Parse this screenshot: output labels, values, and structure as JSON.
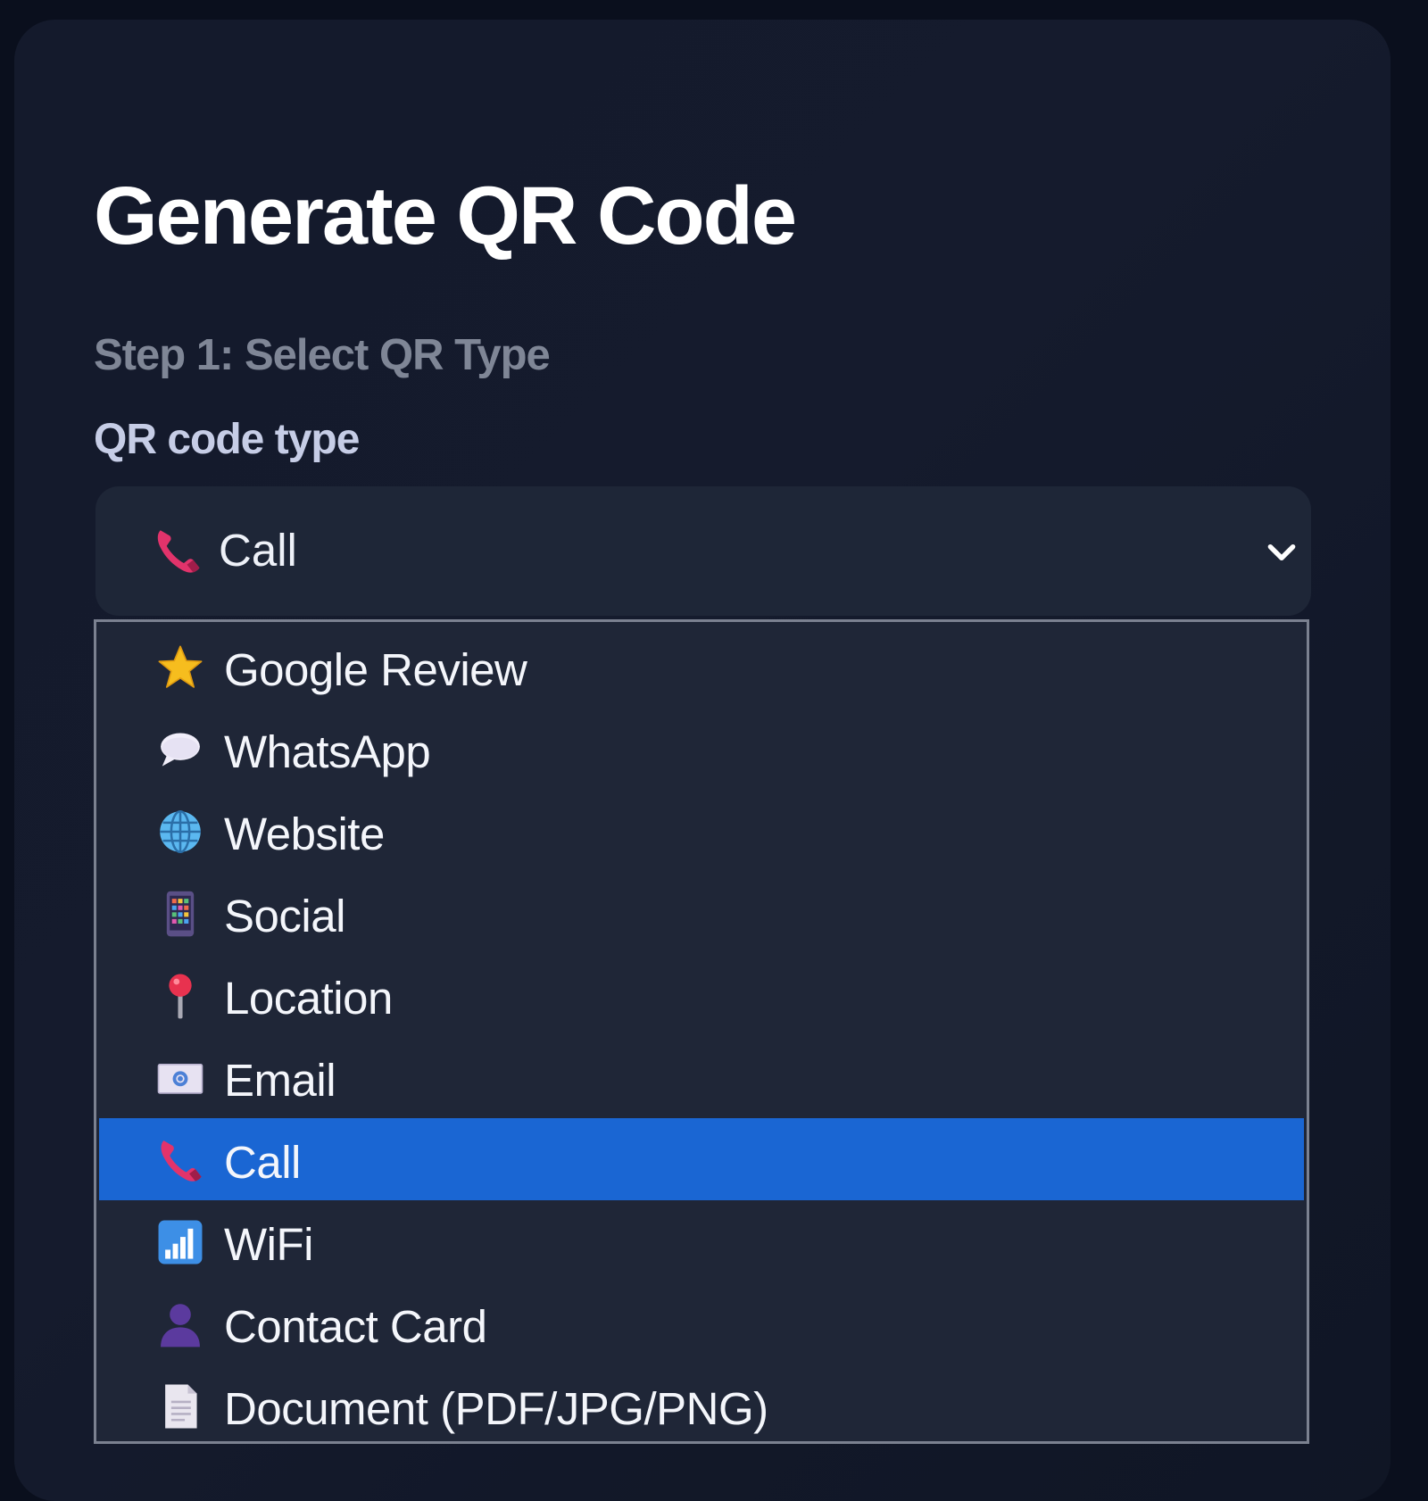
{
  "page": {
    "title": "Generate QR Code",
    "step_label": "Step 1: Select QR Type",
    "field_label": "QR code type"
  },
  "select": {
    "value": "Call",
    "icon": "phone-icon"
  },
  "options": [
    {
      "label": "Google Review",
      "icon": "star-icon"
    },
    {
      "label": "WhatsApp",
      "icon": "speech-bubble-icon"
    },
    {
      "label": "Website",
      "icon": "globe-icon"
    },
    {
      "label": "Social",
      "icon": "mobile-apps-icon"
    },
    {
      "label": "Location",
      "icon": "pin-icon"
    },
    {
      "label": "Email",
      "icon": "email-icon"
    },
    {
      "label": "Call",
      "icon": "phone-icon",
      "selected": true
    },
    {
      "label": "WiFi",
      "icon": "signal-bars-icon"
    },
    {
      "label": "Contact Card",
      "icon": "person-icon"
    },
    {
      "label": "Document (PDF/JPG/PNG)",
      "icon": "document-icon"
    }
  ],
  "colors": {
    "background": "#0a0f1d",
    "card": "#141a2c",
    "select_bg": "#1e2637",
    "selected_option": "#1a66d3"
  }
}
